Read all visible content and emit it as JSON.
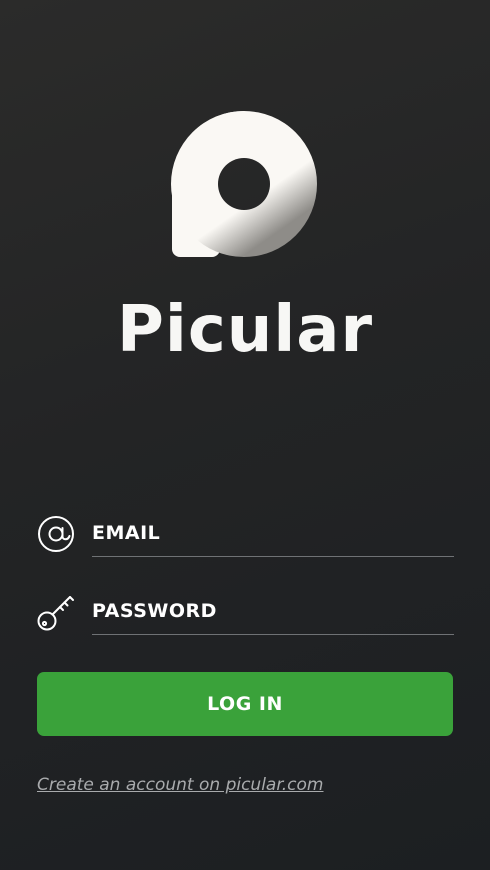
{
  "app": {
    "name": "Picular"
  },
  "icons": {
    "logo": "picular-logo-icon",
    "email": "at-sign-icon",
    "password": "key-icon"
  },
  "form": {
    "email_placeholder": "EMAIL",
    "email_value": "",
    "password_placeholder": "PASSWORD",
    "password_value": "",
    "login_label": "LOG IN"
  },
  "footer": {
    "create_account_label": "Create an account on picular.com"
  },
  "colors": {
    "background": "#242526",
    "accent": "#3aa23a",
    "logo": "#faf8f4",
    "link": "#a9abad",
    "underline": "#6f7275"
  }
}
